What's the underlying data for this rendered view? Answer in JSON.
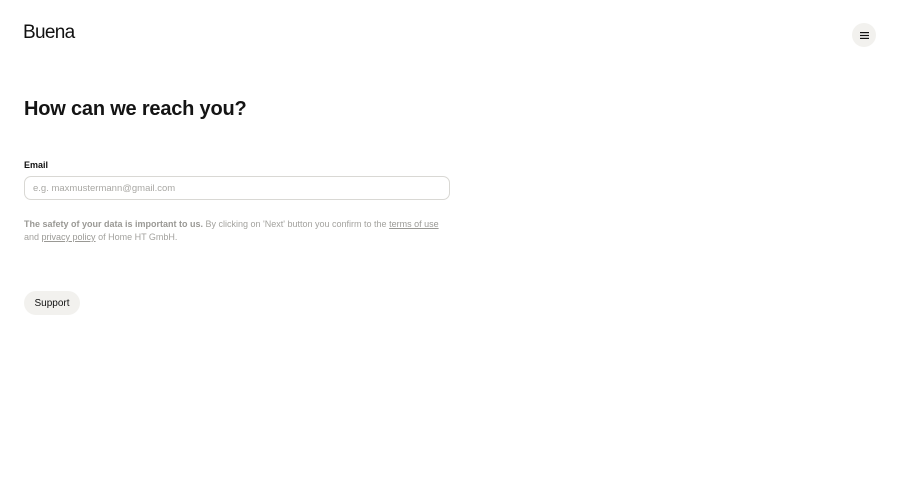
{
  "header": {
    "logo_text": "Buena",
    "menu_icon": "hamburger-menu-icon"
  },
  "main": {
    "heading": "How can we reach you?",
    "email": {
      "label": "Email",
      "value": "",
      "placeholder": "e.g. maxmustermann@gmail.com"
    },
    "consent": {
      "bold_text": "The safety of your data is important to us.",
      "text_1": " By clicking on 'Next' button you confirm to the ",
      "terms_link": "terms of use",
      "text_2": " and ",
      "privacy_link": "privacy policy",
      "text_3": " of Home HT GmbH."
    },
    "support_label": "Support"
  },
  "colors": {
    "background": "#ffffff",
    "text": "#111111",
    "muted_text": "#a3a29e",
    "button_bg": "#f2f1ee",
    "input_border": "#d9d8d4"
  }
}
